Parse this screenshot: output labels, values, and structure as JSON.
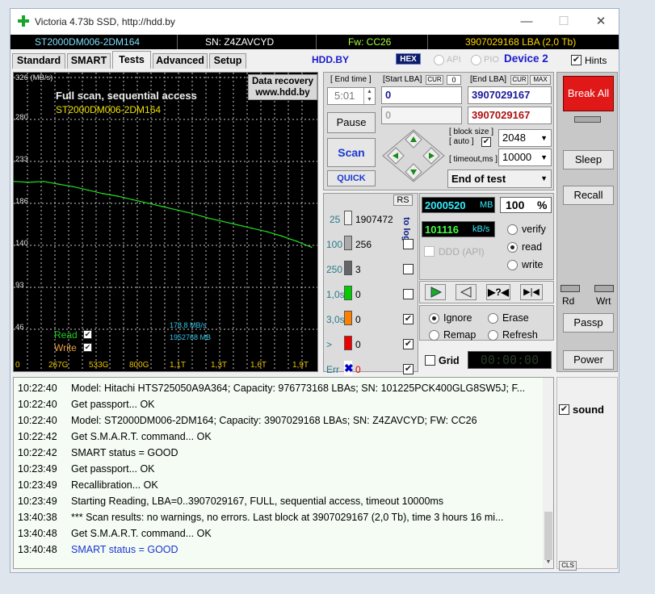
{
  "window": {
    "title": "Victoria 4.73b SSD, http://hdd.by",
    "minimize_glyph": "—",
    "maximize_glyph": "☐",
    "close_glyph": "✕"
  },
  "infobar": {
    "model": "ST2000DM006-2DM164",
    "sn": "SN: Z4ZAVCYD",
    "fw": "Fw: CC26",
    "lba": "3907029168 LBA (2,0 Tb)"
  },
  "tabs": [
    "Standard",
    "SMART",
    "Tests",
    "Advanced",
    "Setup"
  ],
  "active_tab": "Tests",
  "header": {
    "hddby": "HDD.BY",
    "hex": "HEX",
    "api": "API",
    "pio": "PIO",
    "device": "Device 2",
    "hints": "Hints"
  },
  "graph": {
    "unit_label": "326 (MB/s)",
    "title": "Full scan, sequential access",
    "subtitle": "ST2000DM006-2DM164",
    "recovery_line1": "Data recovery",
    "recovery_line2": "www.hdd.by",
    "speed_readout": "178,8 MB/s",
    "mb_readout": "1952768 MB",
    "read_label": "Read",
    "write_label": "Write",
    "check_glyph": "✔"
  },
  "chart_data": {
    "type": "line",
    "ylabel": "(MB/s)",
    "ylim": [
      0,
      326
    ],
    "y_ticks": [
      "326",
      "280",
      "233",
      "186",
      "140",
      "93",
      "46"
    ],
    "x_ticks": [
      "0",
      "267G",
      "533G",
      "800G",
      "1,1T",
      "1,3T",
      "1,6T",
      "1,9T"
    ],
    "series": [
      {
        "name": "Read",
        "color": "#22dd22",
        "x": [
          0,
          100,
          200,
          300,
          400,
          500,
          600,
          700,
          800,
          900,
          1000,
          1100,
          1200,
          1300,
          1400,
          1500,
          1600,
          1700,
          1800,
          1900,
          2000
        ],
        "values": [
          206,
          205,
          206,
          203,
          200,
          196,
          192,
          189,
          185,
          181,
          177,
          173,
          169,
          164,
          160,
          156,
          152,
          148,
          143,
          137,
          130
        ]
      }
    ]
  },
  "controls": {
    "end_time_label": "[ End time ]",
    "end_time_value": "5:01",
    "start_lba_label": "[Start LBA]",
    "cur_label": "CUR",
    "start_cur_value": "0",
    "end_lba_label": "[End LBA]",
    "max_label": "MAX",
    "start_lba_value": "0",
    "end_lba_value": "3907029167",
    "pos_value": "0",
    "pos_end_value": "3907029167",
    "pause": "Pause",
    "scan": "Scan",
    "quick": "QUICK",
    "block_size_label": "[ block size ]",
    "auto_label": "[ auto ]",
    "block_size_value": "2048",
    "timeout_label": "[ timeout,ms ]",
    "timeout_value": "10000",
    "end_action": "End of test"
  },
  "stats": {
    "rs": "RS",
    "to_log": "to log:",
    "rows": [
      {
        "ms": "25",
        "count": "1907472",
        "color": "#f0f0f0",
        "checked": false
      },
      {
        "ms": "100",
        "count": "256",
        "color": "#aaaaaa",
        "checked": false
      },
      {
        "ms": "250",
        "count": "3",
        "color": "#666666",
        "checked": false
      },
      {
        "ms": "1,0s",
        "count": "0",
        "color": "#00cc00",
        "checked": false
      },
      {
        "ms": "3,0s",
        "count": "0",
        "color": "#ff7f00",
        "checked": true
      },
      {
        "ms": ">",
        "count": "0",
        "color": "#ee0000",
        "checked": true
      },
      {
        "ms": "Err",
        "count": "0",
        "color": "#0000cc",
        "checked": true
      }
    ],
    "err_glyph": "✖"
  },
  "progress": {
    "mb_value": "2000520",
    "mb_unit": "MB",
    "percent": "100",
    "percent_unit": "%",
    "speed_value": "101116",
    "speed_unit": "kB/s",
    "ddd": "DDD (API)",
    "verify": "verify",
    "read": "read",
    "write": "write",
    "mode_selected": "read"
  },
  "actions": {
    "ignore": "Ignore",
    "erase": "Erase",
    "remap": "Remap",
    "refresh": "Refresh",
    "selected": "Ignore",
    "grid": "Grid",
    "timer": "00:00:00"
  },
  "right": {
    "break_all": "Break All",
    "sleep": "Sleep",
    "recall": "Recall",
    "rd": "Rd",
    "wrt": "Wrt",
    "passp": "Passp",
    "power": "Power",
    "sound": "sound",
    "cls": "CLS"
  },
  "log": [
    {
      "time": "10:22:40",
      "msg": "Model: Hitachi HTS725050A9A364; Capacity: 976773168 LBAs; SN: 101225PCK400GLG8SW5J; F...",
      "blue": false
    },
    {
      "time": "10:22:40",
      "msg": "Get passport... OK",
      "blue": false
    },
    {
      "time": "10:22:40",
      "msg": "Model: ST2000DM006-2DM164; Capacity: 3907029168 LBAs; SN: Z4ZAVCYD; FW: CC26",
      "blue": false
    },
    {
      "time": "10:22:42",
      "msg": "Get S.M.A.R.T. command... OK",
      "blue": false
    },
    {
      "time": "10:22:42",
      "msg": "SMART status = GOOD",
      "blue": false
    },
    {
      "time": "10:23:49",
      "msg": "Get passport... OK",
      "blue": false
    },
    {
      "time": "10:23:49",
      "msg": "Recallibration... OK",
      "blue": false
    },
    {
      "time": "10:23:49",
      "msg": "Starting Reading, LBA=0..3907029167, FULL, sequential access, timeout 10000ms",
      "blue": false
    },
    {
      "time": "13:40:38",
      "msg": "*** Scan results: no warnings, no errors. Last block at 3907029167 (2,0 Tb), time 3 hours 16 mi...",
      "blue": false
    },
    {
      "time": "13:40:48",
      "msg": "Get S.M.A.R.T. command... OK",
      "blue": false
    },
    {
      "time": "13:40:48",
      "msg": "SMART status = GOOD",
      "blue": true
    }
  ]
}
